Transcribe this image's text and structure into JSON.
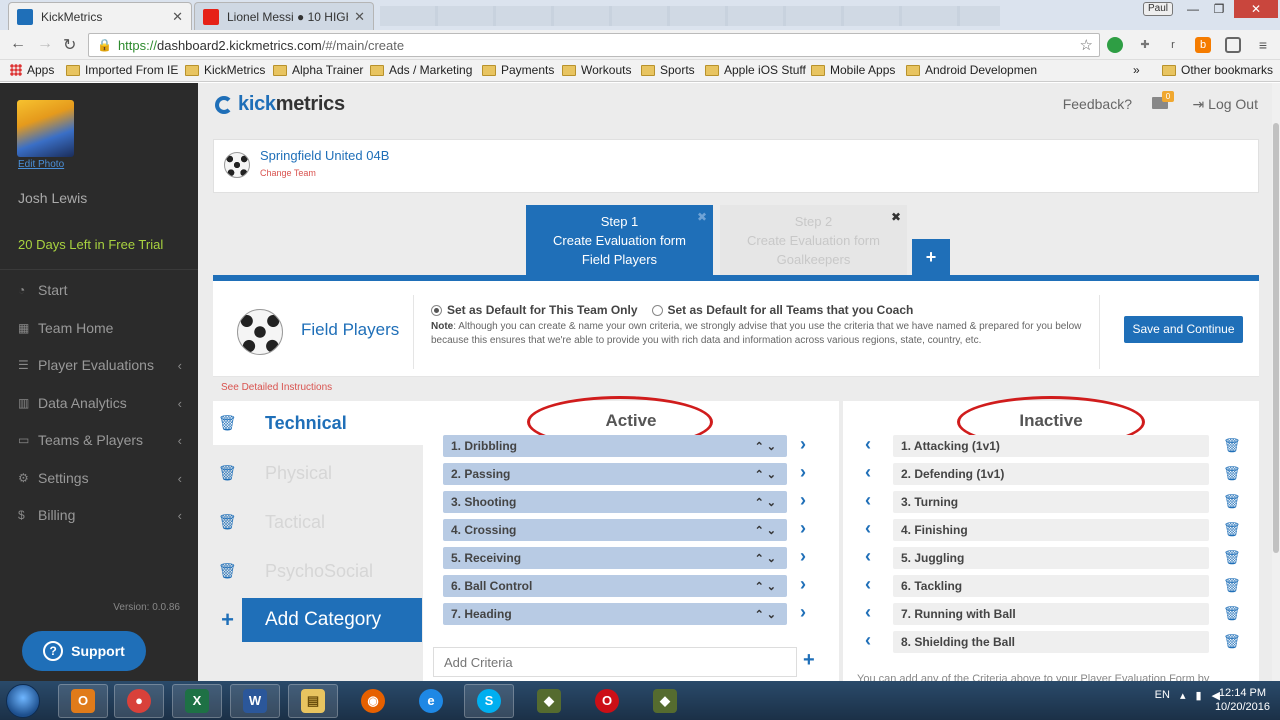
{
  "browser": {
    "tabs": [
      {
        "title": "KickMetrics",
        "favicon_color": "#1f6fb8"
      },
      {
        "title": "Lionel Messi ● 10 HIGH",
        "favicon_color": "#e62117"
      }
    ],
    "user_badge": "Paul",
    "window_buttons": {
      "minimize": "—",
      "restore": "❐",
      "close": "✕"
    },
    "url_scheme": "https://",
    "url_host": "dashboard2.kickmetrics.com",
    "url_path": "/#/main/create",
    "bookmarks": [
      {
        "label": "Apps",
        "type": "apps"
      },
      {
        "label": "Imported From IE",
        "type": "folder"
      },
      {
        "label": "KickMetrics",
        "type": "folder"
      },
      {
        "label": "Alpha Trainer",
        "type": "folder"
      },
      {
        "label": "Ads / Marketing",
        "type": "folder"
      },
      {
        "label": "Payments",
        "type": "folder"
      },
      {
        "label": "Workouts",
        "type": "folder"
      },
      {
        "label": "Sports",
        "type": "folder"
      },
      {
        "label": "Apple iOS Stuff",
        "type": "folder"
      },
      {
        "label": "Mobile Apps",
        "type": "folder"
      },
      {
        "label": "Android Developmen",
        "type": "folder"
      }
    ],
    "bookmarks_overflow": "»",
    "other_bookmarks": "Other bookmarks"
  },
  "sidebar": {
    "edit_photo": "Edit Photo",
    "user_name": "Josh Lewis",
    "trial": "20 Days Left in Free Trial",
    "nav": [
      {
        "label": "Start",
        "icon": "dashboard-icon",
        "glyph": "◔",
        "chevron": false
      },
      {
        "label": "Team Home",
        "icon": "grid-icon",
        "glyph": "▦",
        "chevron": false
      },
      {
        "label": "Player Evaluations",
        "icon": "list-icon",
        "glyph": "☰",
        "chevron": true
      },
      {
        "label": "Data Analytics",
        "icon": "bar-chart-icon",
        "glyph": "▥",
        "chevron": true
      },
      {
        "label": "Teams & Players",
        "icon": "laptop-icon",
        "glyph": "▭",
        "chevron": true
      },
      {
        "label": "Settings",
        "icon": "gear-icon",
        "glyph": "⚙",
        "chevron": true
      },
      {
        "label": "Billing",
        "icon": "dollar-icon",
        "glyph": "$",
        "chevron": true
      }
    ],
    "version": "Version: 0.0.86",
    "support": "Support"
  },
  "header": {
    "logo_part1": "kick",
    "logo_part2": "metrics",
    "feedback": "Feedback?",
    "mail_count": "0",
    "logout": "Log Out"
  },
  "team": {
    "name": "Springfield United 04B",
    "change": "Change Team"
  },
  "steps": [
    {
      "line1": "Step 1",
      "line2": "Create Evaluation form",
      "line3": "Field Players",
      "active": true
    },
    {
      "line1": "Step 2",
      "line2": "Create Evaluation form",
      "line3": "Goalkeepers",
      "active": false
    }
  ],
  "form": {
    "title": "Field Players",
    "radio1": "Set as Default for This Team Only",
    "radio2": "Set as Default for all Teams that you Coach",
    "note_label": "Note",
    "note_text": ": Although you can create & name your own criteria, we strongly advise that you use the criteria that we have named & prepared for you below because this ensures that we're able to provide you with rich data and information across various regions, state, country, etc.",
    "save": "Save and Continue"
  },
  "instructions": "See Detailed Instructions",
  "categories": [
    {
      "label": "Technical",
      "active": true
    },
    {
      "label": "Physical",
      "active": false
    },
    {
      "label": "Tactical",
      "active": false
    },
    {
      "label": "PsychoSocial",
      "active": false
    }
  ],
  "add_category": "Add Category",
  "active": {
    "heading": "Active",
    "items": [
      "1. Dribbling",
      "2. Passing",
      "3. Shooting",
      "4. Crossing",
      "5. Receiving",
      "6. Ball Control",
      "7. Heading"
    ],
    "add_placeholder": "Add Criteria"
  },
  "inactive": {
    "heading": "Inactive",
    "items": [
      "1. Attacking (1v1)",
      "2. Defending (1v1)",
      "3. Turning",
      "4. Finishing",
      "5. Juggling",
      "6. Tackling",
      "7. Running with Ball",
      "8. Shielding the Ball"
    ],
    "note": "You can add any of the Criteria above to your Player Evaluation Form by"
  },
  "taskbar": {
    "apps": [
      {
        "name": "outlook",
        "glyph": "O",
        "color": "#e07b1a",
        "running": true
      },
      {
        "name": "chrome",
        "glyph": "●",
        "color": "#d9413a",
        "running": true
      },
      {
        "name": "excel",
        "glyph": "X",
        "color": "#1e7145",
        "running": true
      },
      {
        "name": "word",
        "glyph": "W",
        "color": "#2b579a",
        "running": true
      },
      {
        "name": "explorer",
        "glyph": "▤",
        "color": "#e8c460",
        "running": true
      },
      {
        "name": "firefox",
        "glyph": "◉",
        "color": "#e66000",
        "running": false
      },
      {
        "name": "internet-explorer",
        "glyph": "e",
        "color": "#1e88e5",
        "running": false
      },
      {
        "name": "skype",
        "glyph": "S",
        "color": "#00aff0",
        "running": true
      },
      {
        "name": "app-9",
        "glyph": "◆",
        "color": "#556b2f",
        "running": false
      },
      {
        "name": "opera",
        "glyph": "O",
        "color": "#cc0f16",
        "running": false
      },
      {
        "name": "app-11",
        "glyph": "◆",
        "color": "#556b2f",
        "running": false
      }
    ],
    "language": "EN",
    "time": "12:14 PM",
    "date": "10/20/2016"
  },
  "colors": {
    "primary": "#1f6fb8",
    "trial": "#a8d23f",
    "annotation": "#d01c1c"
  }
}
